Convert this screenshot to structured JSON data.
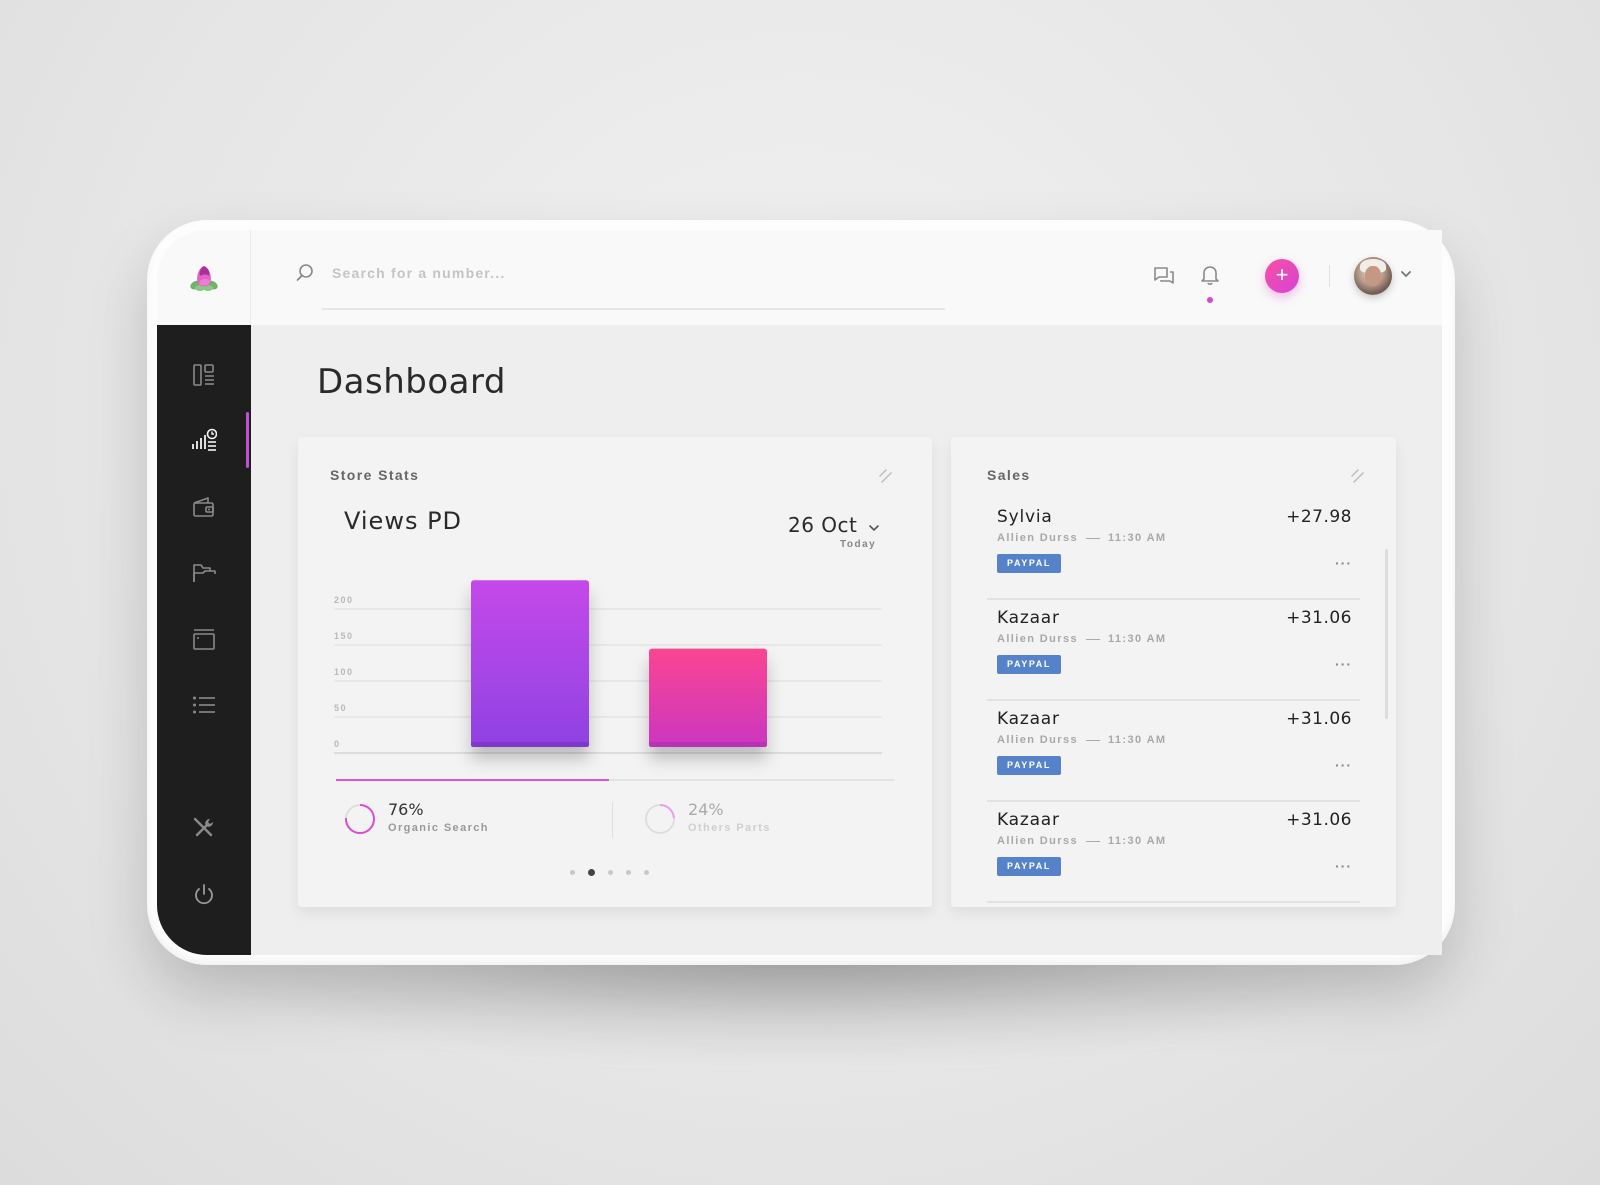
{
  "app": {
    "logo": "lotus-bud-logo",
    "accent_color": "#d04ad6",
    "sidebar_bg": "#1e1e1e"
  },
  "topbar": {
    "search_placeholder": "Search for a number...",
    "icons": [
      "search-icon",
      "chat-icon",
      "bell-icon",
      "plus-icon",
      "chevron-down-icon"
    ],
    "add_label": "+",
    "has_notification": true
  },
  "sidebar": {
    "items": [
      {
        "name": "layout-icon",
        "active": false
      },
      {
        "name": "analytics-icon",
        "active": true
      },
      {
        "name": "wallet-icon",
        "active": false
      },
      {
        "name": "folder-icon",
        "active": false
      },
      {
        "name": "browser-window-icon",
        "active": false
      },
      {
        "name": "list-icon",
        "active": false
      },
      {
        "name": "tools-icon",
        "active": false
      },
      {
        "name": "power-icon",
        "active": false
      }
    ]
  },
  "page": {
    "title": "Dashboard"
  },
  "store_stats": {
    "title": "Store Stats",
    "chart_title": "Views PD",
    "date": "26 Oct",
    "date_sub": "Today",
    "progress": 0.49,
    "metrics": [
      {
        "value": "76%",
        "label": "Organic Search",
        "fraction": 0.76
      },
      {
        "value": "24%",
        "label": "Others Parts",
        "fraction": 0.24
      }
    ],
    "pager": {
      "count": 5,
      "active": 1
    }
  },
  "chart_data": {
    "type": "bar",
    "title": "Views PD",
    "xlabel": "",
    "ylabel": "",
    "categories": [
      "Organic Search",
      "Others Parts"
    ],
    "values": [
      240,
      145
    ],
    "colors": [
      [
        "#c548ea",
        "#8f42e2"
      ],
      [
        "#fb4591",
        "#cb36c1"
      ]
    ],
    "yticks": [
      0,
      50,
      100,
      150,
      200
    ],
    "ylim": [
      0,
      250
    ],
    "grid": true
  },
  "sales": {
    "title": "Sales",
    "items": [
      {
        "name": "Sylvia",
        "amount": "+27.98",
        "customer": "Allien Durss",
        "time": "11:30 AM",
        "method": "PAYPAL",
        "more": "···"
      },
      {
        "name": "Kazaar",
        "amount": "+31.06",
        "customer": "Allien Durss",
        "time": "11:30 AM",
        "method": "PAYPAL",
        "more": "···"
      },
      {
        "name": "Kazaar",
        "amount": "+31.06",
        "customer": "Allien Durss",
        "time": "11:30 AM",
        "method": "PAYPAL",
        "more": "···"
      },
      {
        "name": "Kazaar",
        "amount": "+31.06",
        "customer": "Allien Durss",
        "time": "11:30 AM",
        "method": "PAYPAL",
        "more": "···"
      }
    ]
  }
}
